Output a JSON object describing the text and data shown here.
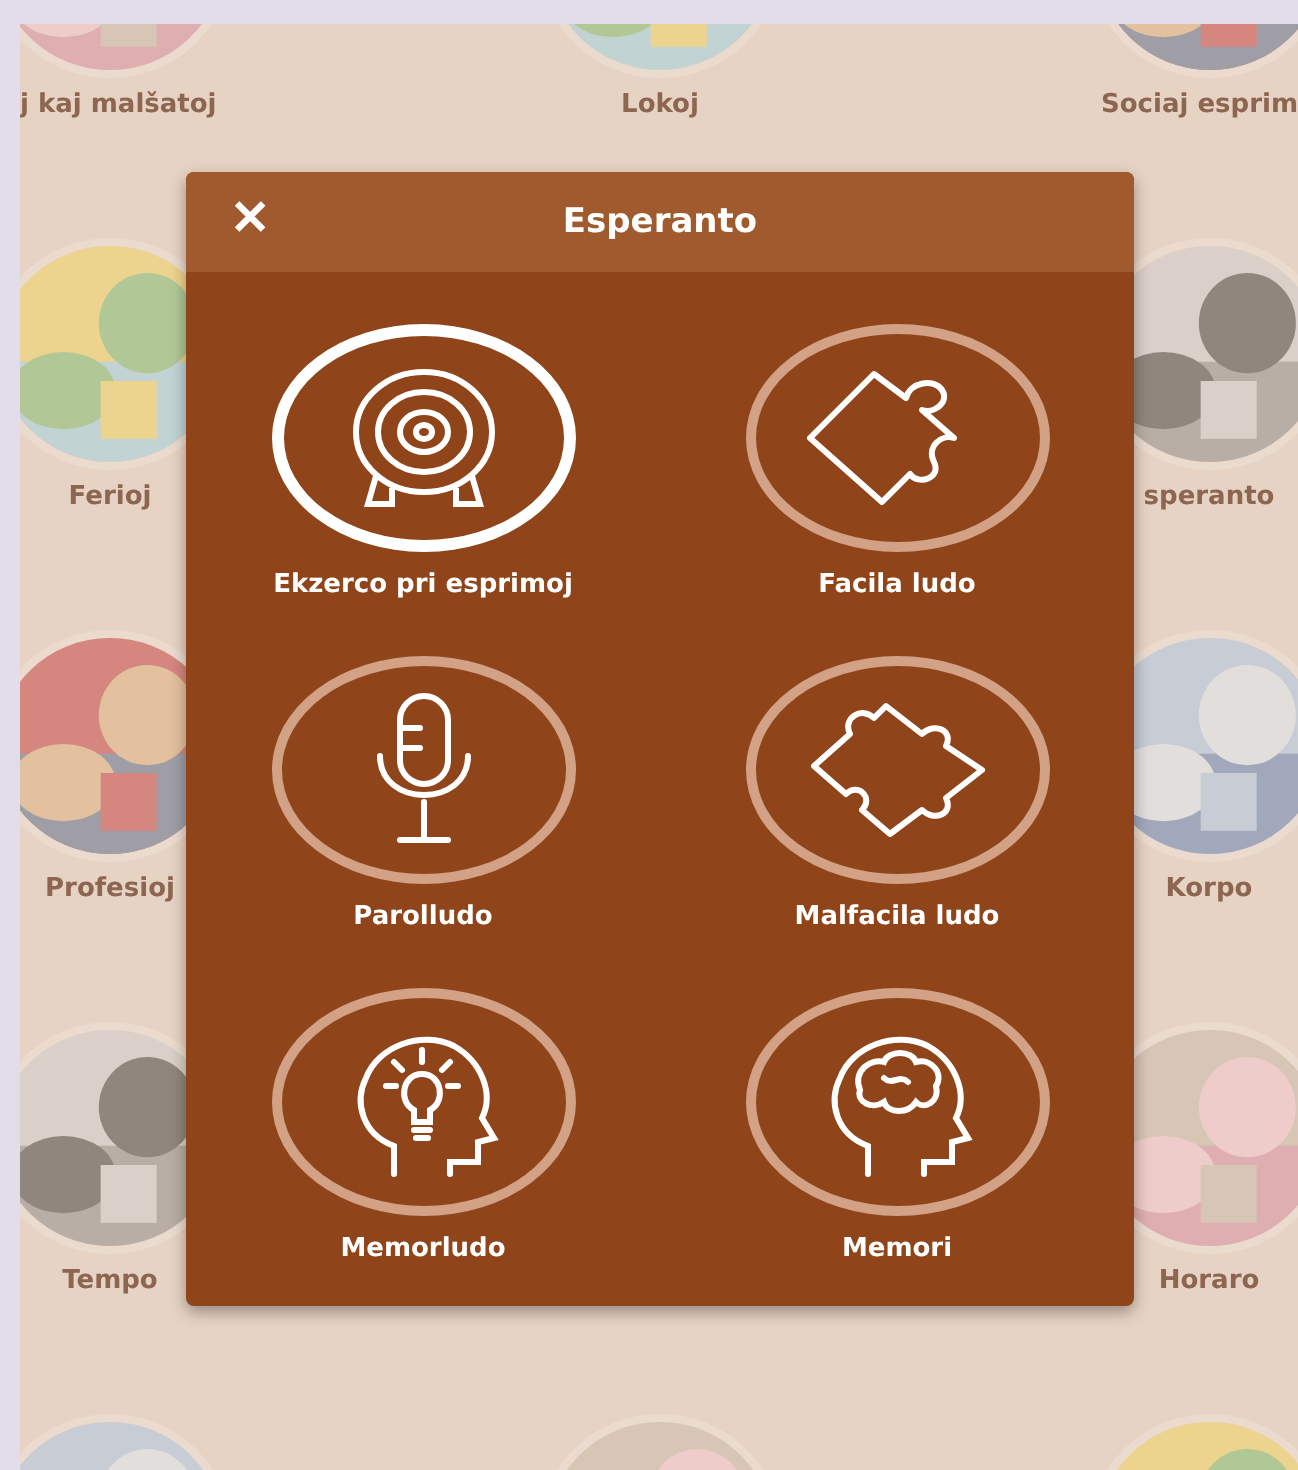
{
  "background_rows": [
    {
      "left": {
        "label": "j kaj malšatoj",
        "kind": "picture"
      },
      "center": {
        "label": "Lokoj",
        "kind": "picture"
      },
      "right": {
        "label": "Sociaj esprim",
        "kind": "picture"
      }
    },
    {
      "left": {
        "label": "Ferioj",
        "kind": "picture"
      },
      "right": {
        "label": "speranto",
        "kind": "picture"
      }
    },
    {
      "left": {
        "label": "Profesioj",
        "kind": "picture"
      },
      "right": {
        "label": "Korpo",
        "kind": "picture"
      }
    },
    {
      "left": {
        "label": "Tempo",
        "kind": "picture"
      },
      "right": {
        "label": "Horaro",
        "kind": "picture"
      }
    },
    {
      "left": {
        "kind": "picture"
      },
      "center": {
        "kind": "picture"
      },
      "right": {
        "kind": "picture"
      }
    }
  ],
  "dialog": {
    "close": "✕",
    "title": "Esperanto",
    "items": [
      {
        "label": "Ekzerco pri esprimoj",
        "selected": true
      },
      {
        "label": "Facila ludo",
        "selected": false
      },
      {
        "label": "Parolludo",
        "selected": false
      },
      {
        "label": "Malfacila ludo",
        "selected": false
      },
      {
        "label": "Memorludo",
        "selected": false
      },
      {
        "label": "Memori",
        "selected": false
      }
    ]
  }
}
